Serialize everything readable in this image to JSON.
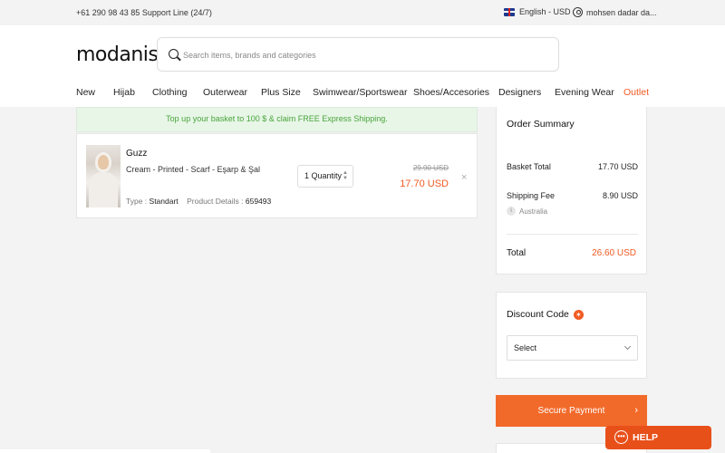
{
  "topbar": {
    "support": "+61 290 98 43 85 Support Line (24/7)",
    "language": "English - USD",
    "user": "mohsen dadar da..."
  },
  "header": {
    "logo": "modanisa",
    "search_placeholder": "Search items, brands and categories"
  },
  "nav": {
    "items": [
      "New",
      "Hijab",
      "Clothing",
      "Outerwear",
      "Plus Size",
      "Swimwear/Sportswear",
      "Shoes/Accesories",
      "Designers",
      "Evening Wear",
      "Outlet"
    ]
  },
  "banner": {
    "text": "Top up your basket to 100 $ & claim FREE Express Shipping."
  },
  "cart_item": {
    "brand": "Guzz",
    "name": "Cream - Printed - Scarf - Eşarp & Şal",
    "type_label": "Type :",
    "type_value": "Standart",
    "details_label": "Product Details :",
    "details_value": "659493",
    "quantity": "1 Quantity",
    "old_price": "29.90 USD",
    "price": "17.70 USD",
    "remove": "×"
  },
  "summary": {
    "title": "Order Summary",
    "basket_label": "Basket Total",
    "basket_value": "17.70 USD",
    "shipping_label": "Shipping Fee",
    "shipping_value": "8.90 USD",
    "shipping_country": "Australia",
    "total_label": "Total",
    "total_value": "26.60 USD"
  },
  "discount": {
    "title": "Discount Code",
    "select": "Select"
  },
  "payment": {
    "label": "Secure Payment"
  },
  "help": {
    "label": "HELP"
  },
  "colors": {
    "accent": "#f15a22",
    "banner_text": "#4aa33b"
  }
}
